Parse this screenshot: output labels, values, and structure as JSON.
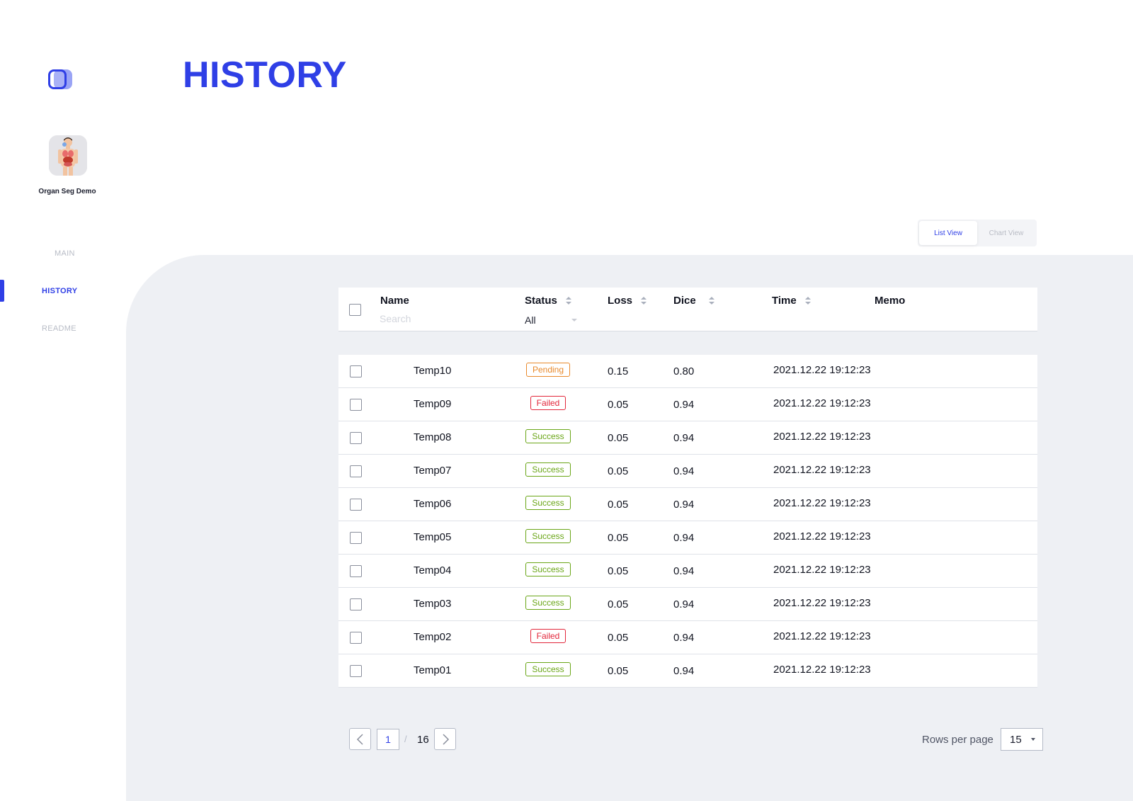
{
  "sidebar": {
    "project_name": "Organ Seg Demo",
    "nav": [
      {
        "label": "MAIN"
      },
      {
        "label": "HISTORY",
        "active": true
      },
      {
        "label": "README"
      }
    ]
  },
  "header": {
    "title": "HISTORY"
  },
  "view_toggle": {
    "list": "List View",
    "chart": "Chart View",
    "active": "List View"
  },
  "table": {
    "columns": {
      "name": "Name",
      "status": "Status",
      "loss": "Loss",
      "dice": "Dice",
      "time": "Time",
      "memo": "Memo"
    },
    "search_placeholder": "Search",
    "status_filter": "All",
    "rows": [
      {
        "name": "Temp10",
        "status": "Pending",
        "loss": "0.15",
        "dice": "0.80",
        "time": "2021.12.22 19:12:23",
        "memo": ""
      },
      {
        "name": "Temp09",
        "status": "Failed",
        "loss": "0.05",
        "dice": "0.94",
        "time": "2021.12.22 19:12:23",
        "memo": ""
      },
      {
        "name": "Temp08",
        "status": "Success",
        "loss": "0.05",
        "dice": "0.94",
        "time": "2021.12.22 19:12:23",
        "memo": ""
      },
      {
        "name": "Temp07",
        "status": "Success",
        "loss": "0.05",
        "dice": "0.94",
        "time": "2021.12.22 19:12:23",
        "memo": ""
      },
      {
        "name": "Temp06",
        "status": "Success",
        "loss": "0.05",
        "dice": "0.94",
        "time": "2021.12.22 19:12:23",
        "memo": ""
      },
      {
        "name": "Temp05",
        "status": "Success",
        "loss": "0.05",
        "dice": "0.94",
        "time": "2021.12.22 19:12:23",
        "memo": ""
      },
      {
        "name": "Temp04",
        "status": "Success",
        "loss": "0.05",
        "dice": "0.94",
        "time": "2021.12.22 19:12:23",
        "memo": ""
      },
      {
        "name": "Temp03",
        "status": "Success",
        "loss": "0.05",
        "dice": "0.94",
        "time": "2021.12.22 19:12:23",
        "memo": ""
      },
      {
        "name": "Temp02",
        "status": "Failed",
        "loss": "0.05",
        "dice": "0.94",
        "time": "2021.12.22 19:12:23",
        "memo": ""
      },
      {
        "name": "Temp01",
        "status": "Success",
        "loss": "0.05",
        "dice": "0.94",
        "time": "2021.12.22 19:12:23",
        "memo": ""
      }
    ]
  },
  "pagination": {
    "current_page": "1",
    "separator": "/",
    "total_pages": "16",
    "rows_per_page_label": "Rows per page",
    "rows_per_page": "15"
  },
  "colors": {
    "accent": "#2f3fe6",
    "panel_bg": "#eef0f4",
    "success": "#6aa617",
    "failed": "#e2263a",
    "pending": "#e8892b"
  },
  "icons": {
    "logo": "app-logo-icon",
    "avatar": "human-anatomy-icon",
    "sort": "sort-arrows-icon",
    "prev": "chevron-left-icon",
    "next": "chevron-right-icon",
    "dropdown": "caret-down-icon"
  }
}
